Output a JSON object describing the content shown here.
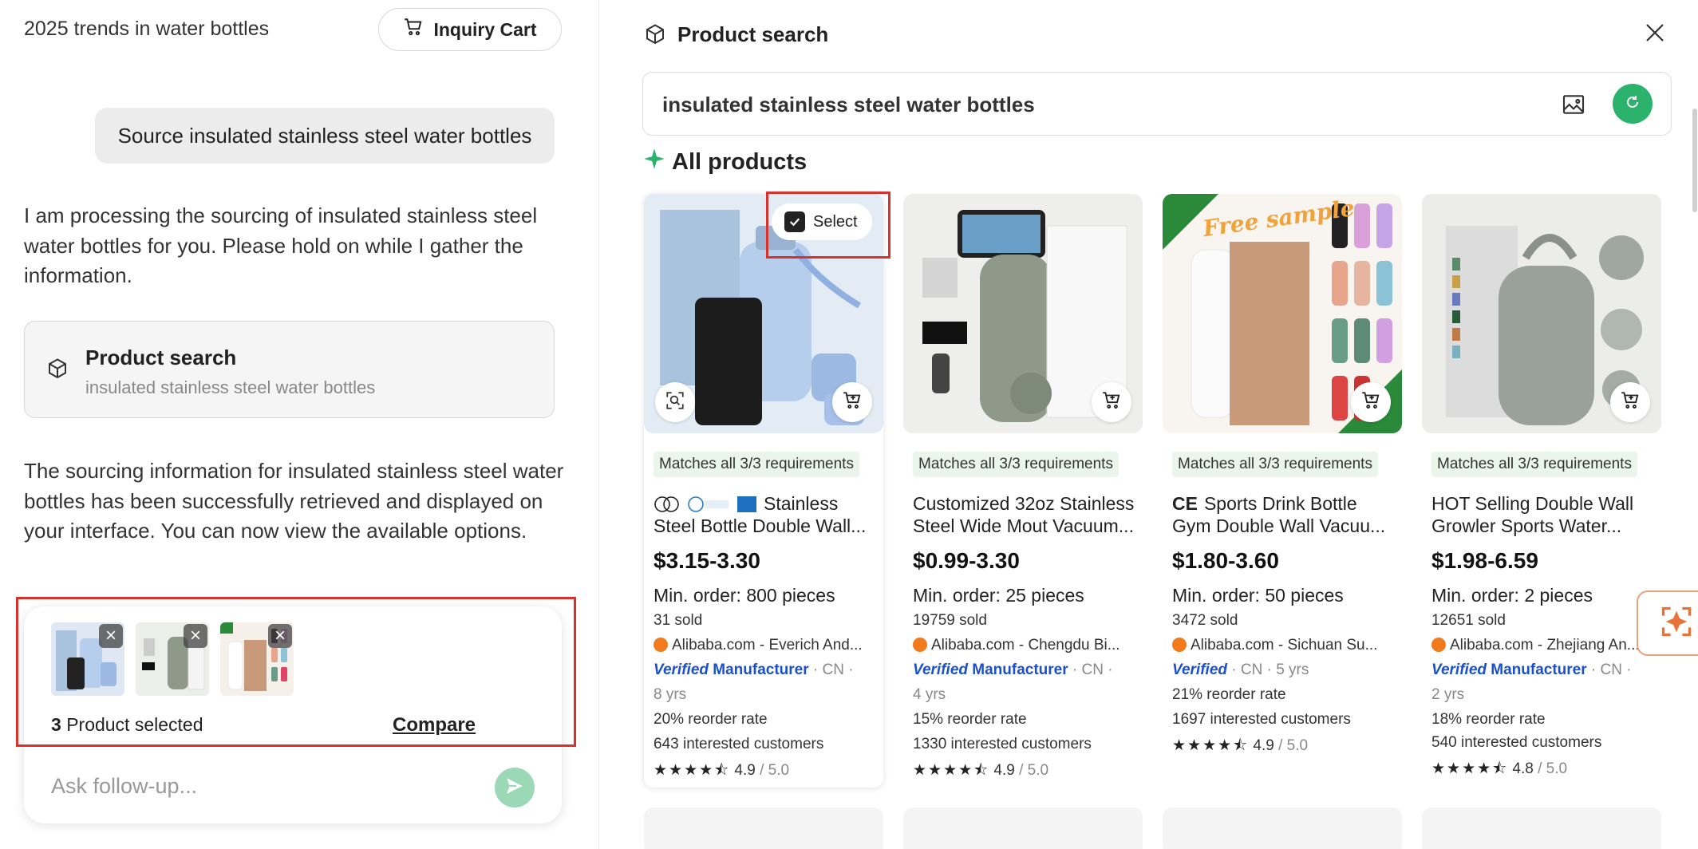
{
  "chat": {
    "title": "2025 trends in water bottles",
    "cart_label": "Inquiry Cart",
    "user_message": "Source insulated stainless steel water bottles",
    "assistant_1": "I am processing the sourcing of insulated stainless steel water bottles for you. Please hold on while I gather the information.",
    "tool_card": {
      "title": "Product search",
      "query": "insulated stainless steel water bottles"
    },
    "assistant_2": "The sourcing information for insulated stainless steel water bottles has been successfully retrieved and displayed on your interface. You can now view the available options.",
    "selection": {
      "count": "3",
      "count_suffix": "Product selected",
      "compare_label": "Compare"
    },
    "composer_placeholder": "Ask follow-up..."
  },
  "panel": {
    "title": "Product search",
    "query": "insulated stainless steel water bottles",
    "section_title": "All products",
    "select_label": "Select",
    "products": [
      {
        "match": "Matches all 3/3 requirements",
        "title": "Stainless Steel Bottle Double Wall...",
        "price": "$3.15-3.30",
        "moq": "Min. order: 800 pieces",
        "sold": "31 sold",
        "supplier": "Alibaba.com - Everich And...",
        "verified": "Verified",
        "manufacturer": "Manufacturer",
        "country": "· CN ·",
        "years": "8 yrs",
        "reorder": "20% reorder rate",
        "interested": "643 interested customers",
        "rating": "4.9",
        "rating_max": "/ 5.0"
      },
      {
        "match": "Matches all 3/3 requirements",
        "title": "Customized 32oz Stainless Steel Wide Mout Vacuum...",
        "price": "$0.99-3.30",
        "moq": "Min. order: 25 pieces",
        "sold": "19759 sold",
        "supplier": "Alibaba.com - Chengdu Bi...",
        "verified": "Verified",
        "manufacturer": "Manufacturer",
        "country": "· CN ·",
        "years": "4 yrs",
        "reorder": "15% reorder rate",
        "interested": "1330 interested customers",
        "rating": "4.9",
        "rating_max": "/ 5.0"
      },
      {
        "match": "Matches all 3/3 requirements",
        "title": "Sports Drink Bottle Gym Double Wall Vacuu...",
        "price": "$1.80-3.60",
        "moq": "Min. order: 50 pieces",
        "sold": "3472 sold",
        "supplier": "Alibaba.com - Sichuan Su...",
        "verified": "Verified",
        "country_years": "· CN · 5 yrs",
        "reorder": "21% reorder rate",
        "interested": "1697 interested customers",
        "rating": "4.9",
        "rating_max": "/ 5.0",
        "image_text": "Free sample"
      },
      {
        "match": "Matches all 3/3 requirements",
        "title": "HOT Selling Double Wall Growler Sports Water...",
        "price": "$1.98-6.59",
        "moq": "Min. order: 2 pieces",
        "sold": "12651 sold",
        "supplier": "Alibaba.com - Zhejiang An...",
        "verified": "Verified",
        "manufacturer": "Manufacturer",
        "country": "· CN ·",
        "years": "2 yrs",
        "reorder": "18% reorder rate",
        "interested": "540 interested customers",
        "rating": "4.8",
        "rating_max": "/ 5.0"
      }
    ]
  },
  "colors": {
    "accent_green": "#2bb36d",
    "highlight_red": "#d9322b",
    "verified_blue": "#1a4fd0",
    "badge_bg": "#eaf5ec"
  }
}
